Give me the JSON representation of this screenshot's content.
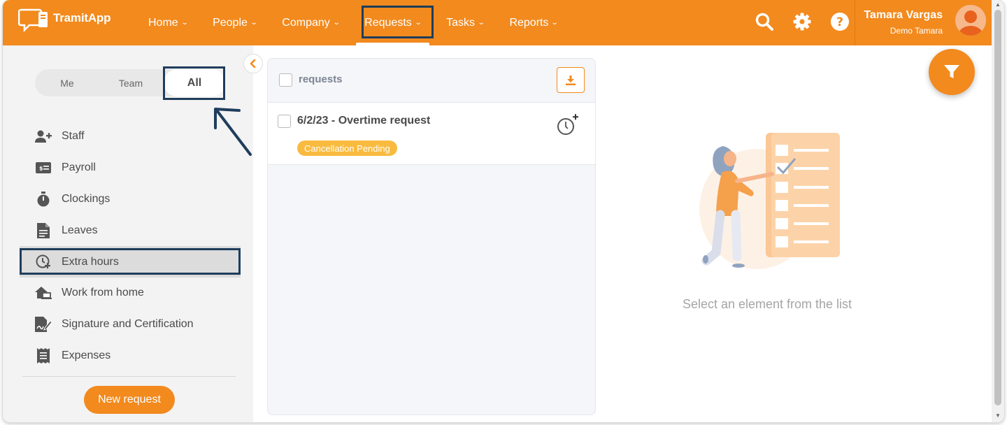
{
  "app": {
    "logo_text": "TramitApp",
    "brand_color": "#f28a1e",
    "accent_dark": "#1f3d5c"
  },
  "nav": [
    {
      "label": "Home",
      "icon": "chevron-down-icon"
    },
    {
      "label": "People",
      "icon": "chevron-down-icon"
    },
    {
      "label": "Company",
      "icon": "chevron-down-icon"
    },
    {
      "label": "Requests",
      "icon": "chevron-down-icon",
      "active": true
    },
    {
      "label": "Tasks",
      "icon": "chevron-down-icon"
    },
    {
      "label": "Reports",
      "icon": "chevron-down-icon"
    }
  ],
  "header_icons": [
    "search-icon",
    "gear-icon",
    "help-icon"
  ],
  "user": {
    "name": "Tamara Vargas",
    "company": "Demo Tamara",
    "avatar_icon": "user-avatar-icon"
  },
  "sidebar": {
    "scope_tabs": [
      {
        "label": "Me"
      },
      {
        "label": "Team"
      },
      {
        "label": "All",
        "selected": true
      }
    ],
    "items": [
      {
        "label": "Staff",
        "icon": "add-user-icon"
      },
      {
        "label": "Payroll",
        "icon": "payroll-icon"
      },
      {
        "label": "Clockings",
        "icon": "stopwatch-icon"
      },
      {
        "label": "Leaves",
        "icon": "document-icon"
      },
      {
        "label": "Extra hours",
        "icon": "clock-plus-icon",
        "selected": true
      },
      {
        "label": "Work from home",
        "icon": "home-laptop-icon"
      },
      {
        "label": "Signature and Certification",
        "icon": "signature-icon"
      },
      {
        "label": "Expenses",
        "icon": "receipt-icon"
      }
    ],
    "new_request_label": "New request",
    "collapse_icon": "chevron-left-icon"
  },
  "list": {
    "header_label": "requests",
    "download_icon": "download-icon",
    "rows": [
      {
        "title": "6/2/23 - Overtime request",
        "status": "Cancellation Pending",
        "status_color": "#f9bb3f",
        "icon": "clock-plus-icon"
      }
    ]
  },
  "detail": {
    "empty_message": "Select an element from the list",
    "illustration": "checklist-illustration"
  },
  "filter_icon": "filter-icon"
}
